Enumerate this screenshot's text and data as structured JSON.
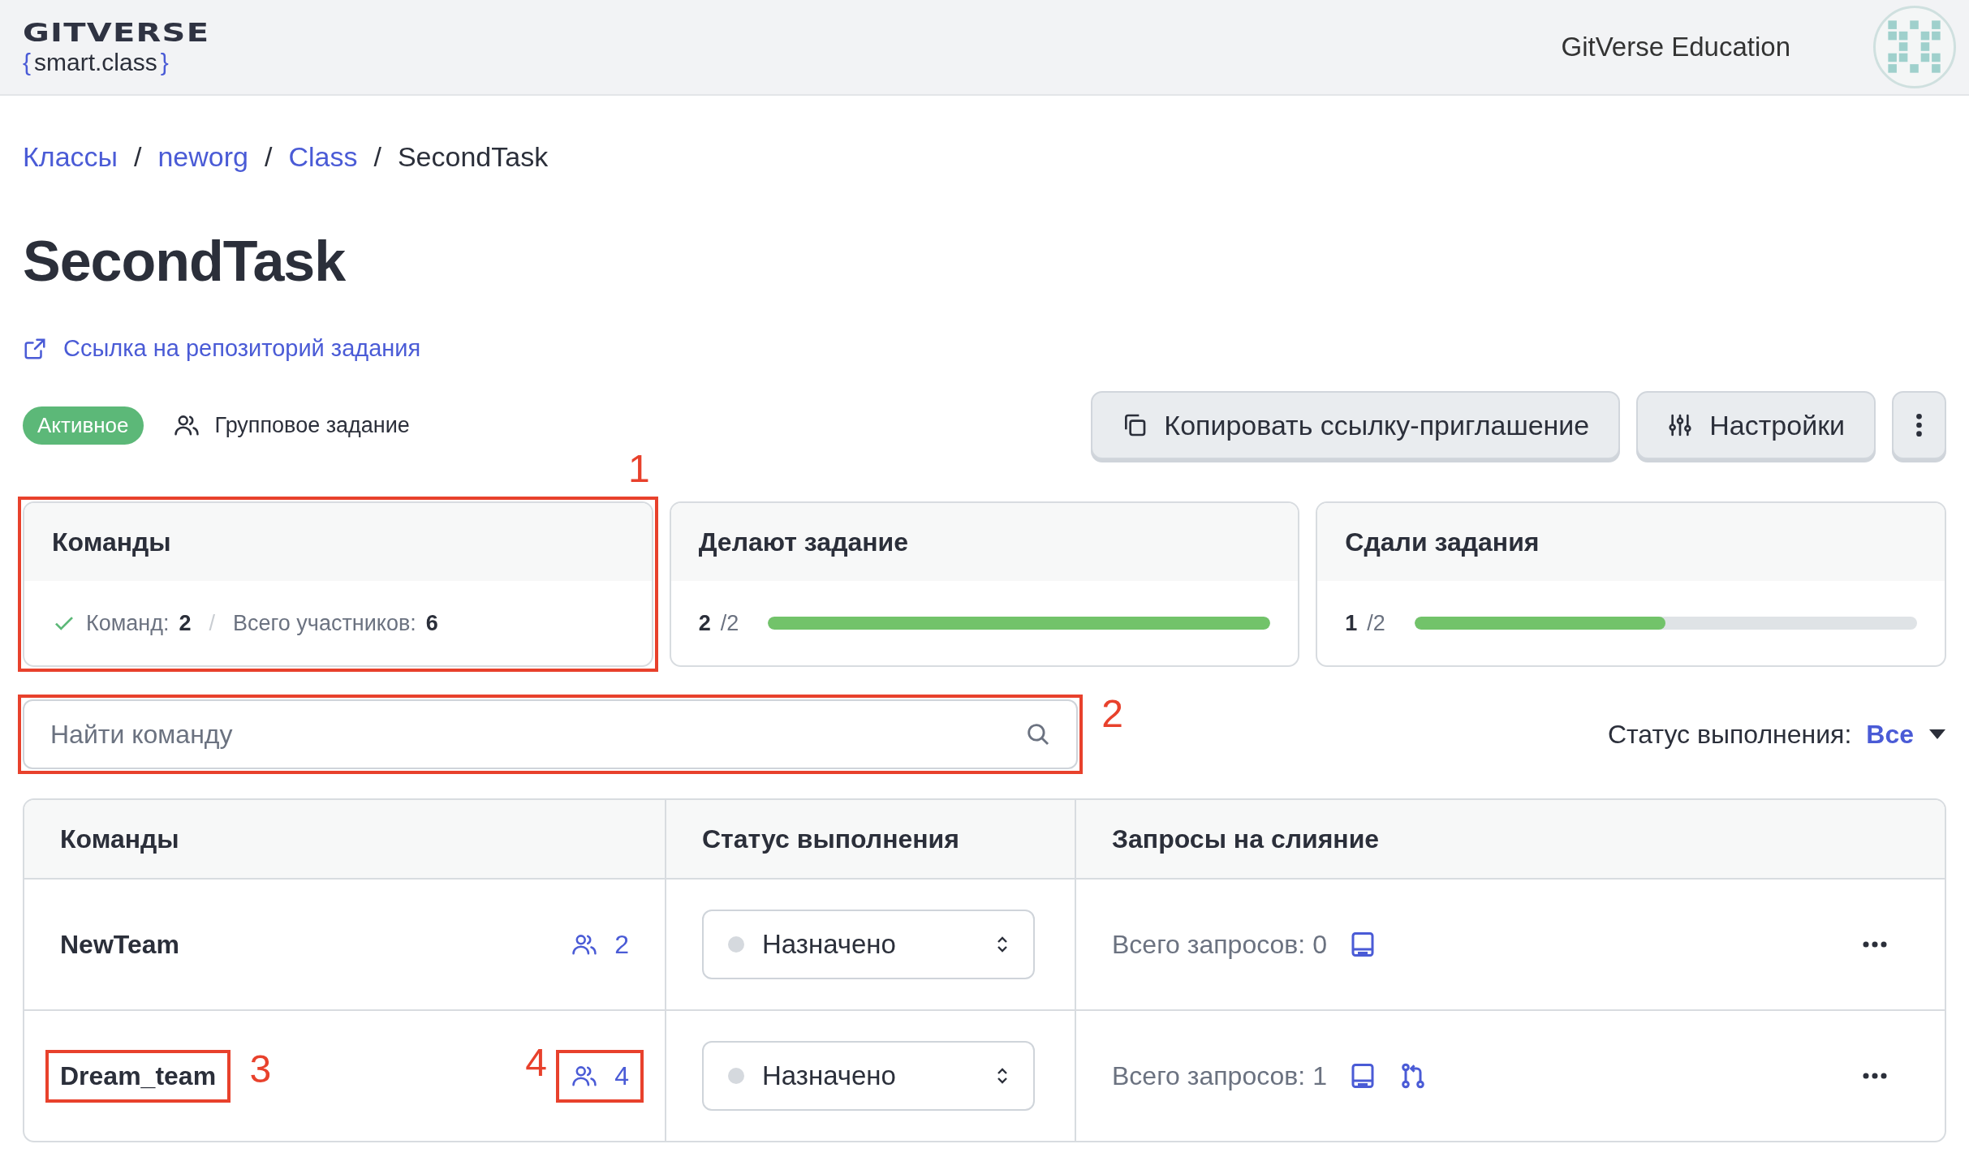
{
  "header": {
    "logo_title": "GITVERSE",
    "logo_brace_open": "{",
    "logo_subtitle": "smart.class",
    "logo_brace_close": "}",
    "org": "GitVerse Education"
  },
  "breadcrumbs": [
    {
      "label": "Классы",
      "kind": "link"
    },
    {
      "separator": "/",
      "label": "neworg",
      "kind": "link"
    },
    {
      "separator": "/",
      "label": "Class",
      "kind": "link"
    },
    {
      "separator": "/",
      "label": "SecondTask",
      "kind": "current"
    }
  ],
  "title": "SecondTask",
  "repo_link": "Ссылка на репозиторий задания",
  "status_badge": "Активное",
  "task_type": "Групповое задание",
  "actions": [
    {
      "kind": "copy",
      "label": "Копировать ссылку-приглашение"
    },
    {
      "kind": "settings",
      "label": "Настройки"
    },
    {
      "kind": "more"
    }
  ],
  "cards": [
    {
      "kind": "summary",
      "title": "Команды",
      "teams_label": "Команд:",
      "teams_value": "2",
      "separator": "/",
      "members_label": "Всего участников:",
      "members_value": "6",
      "annotation": "1"
    },
    {
      "kind": "progress",
      "title": "Делают задание",
      "done": "2",
      "total": "/2",
      "level": 1
    },
    {
      "kind": "progress",
      "title": "Сдали задания",
      "done": "1",
      "total": "/2",
      "level": 0.5
    }
  ],
  "search": {
    "placeholder": "Найти команду",
    "annotation": "2"
  },
  "filter": {
    "label": "Статус выполнения:",
    "value": "Все"
  },
  "table": {
    "columns": [
      "Команды",
      "Статус выполнения",
      "Запросы на слияние"
    ],
    "rows": [
      {
        "team": "NewTeam",
        "members": "2",
        "status": "Назначено",
        "requests": "Всего запросов: 0",
        "has_merge": false
      },
      {
        "team": "Dream_team",
        "members": "4",
        "status": "Назначено",
        "requests": "Всего запросов: 1",
        "has_merge": true,
        "team_annotation": "3",
        "members_annotation": "4"
      }
    ]
  }
}
